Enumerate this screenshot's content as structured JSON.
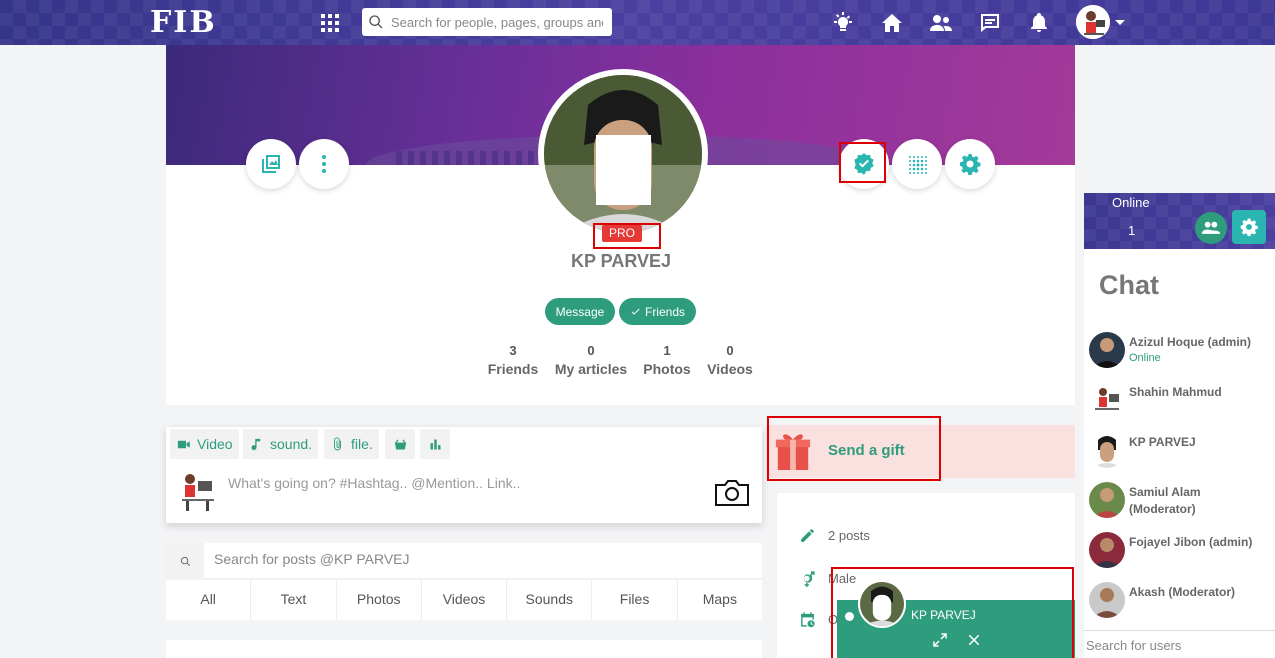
{
  "topbar": {
    "logo": "FIB",
    "search_placeholder": "Search for people, pages, groups and #hashtags"
  },
  "profile": {
    "badge": "PRO",
    "name": "KP PARVEJ",
    "message_label": "Message",
    "friends_label": "Friends",
    "stats": [
      {
        "value": "3",
        "label": "Friends"
      },
      {
        "value": "0",
        "label": "My articles"
      },
      {
        "value": "1",
        "label": "Photos"
      },
      {
        "value": "0",
        "label": "Videos"
      }
    ]
  },
  "composer": {
    "tools": [
      "Video",
      "sound.",
      "file."
    ],
    "placeholder": "What's going on? #Hashtag.. @Mention.. Link.."
  },
  "post_search": {
    "placeholder": "Search for posts @KP PARVEJ"
  },
  "tabs": [
    "All",
    "Text",
    "Photos",
    "Videos",
    "Sounds",
    "Files",
    "Maps"
  ],
  "gift": {
    "label": "Send a gift"
  },
  "info": {
    "posts": "2 posts",
    "gender": "Male",
    "date_prefix": "O"
  },
  "chat_popup": {
    "name": "KP PARVEJ"
  },
  "sidebar": {
    "online_label": "Online",
    "online_count": "1",
    "title": "Chat",
    "users": [
      {
        "name": "Azizul Hoque (admin)",
        "status": "Online"
      },
      {
        "name": "Shahin Mahmud",
        "status": ""
      },
      {
        "name": "KP PARVEJ",
        "status": ""
      },
      {
        "name": "Samiul Alam (Moderator)",
        "status": ""
      },
      {
        "name": "Fojayel Jibon (admin)",
        "status": ""
      },
      {
        "name": "Akash (Moderator)",
        "status": ""
      }
    ],
    "search_placeholder": "Search for users"
  },
  "colors": {
    "accent": "#2e9d7d",
    "nav": "#3d3b91",
    "pro_badge": "#e53935",
    "gift_bg": "#fbe0e0"
  }
}
